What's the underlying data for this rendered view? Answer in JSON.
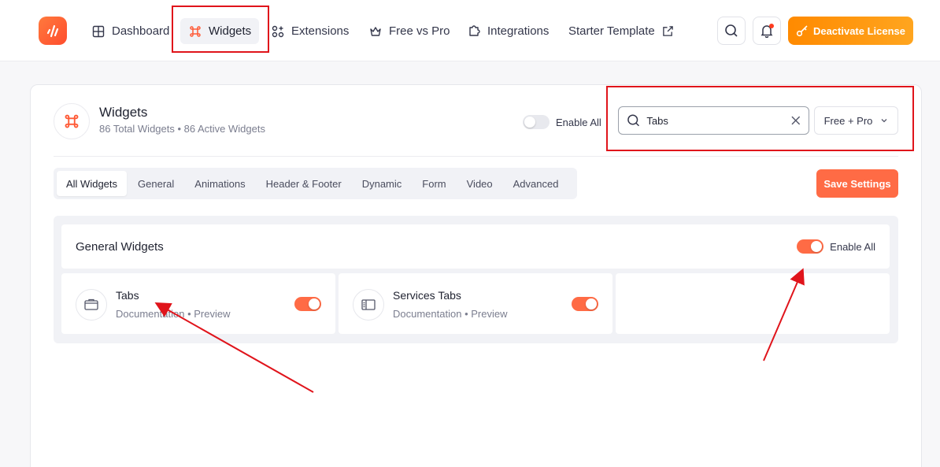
{
  "nav": {
    "items": [
      {
        "label": "Dashboard",
        "icon": "grid-icon"
      },
      {
        "label": "Widgets",
        "icon": "command-icon",
        "active": true
      },
      {
        "label": "Extensions",
        "icon": "extensions-icon"
      },
      {
        "label": "Free vs Pro",
        "icon": "crown-icon"
      },
      {
        "label": "Integrations",
        "icon": "puzzle-icon"
      },
      {
        "label": "Starter Template",
        "icon": "external-link-icon"
      }
    ],
    "deactivate_label": "Deactivate License"
  },
  "widgets": {
    "title": "Widgets",
    "subtitle": "86 Total Widgets • 86 Active Widgets",
    "enable_all_label": "Enable All",
    "enable_all_on": false,
    "search": {
      "value": "Tabs",
      "placeholder": "Search"
    },
    "filter_label": "Free + Pro",
    "tabs": [
      "All Widgets",
      "General",
      "Animations",
      "Header & Footer",
      "Dynamic",
      "Form",
      "Video",
      "Advanced"
    ],
    "active_tab": "All Widgets",
    "save_label": "Save Settings"
  },
  "group": {
    "title": "General Widgets",
    "enable_all_label": "Enable All",
    "enable_all_on": true,
    "items": [
      {
        "name": "Tabs",
        "doc_label": "Documentation",
        "separator": "•",
        "preview_label": "Preview",
        "enabled": true,
        "icon": "browser-tabs-icon"
      },
      {
        "name": "Services Tabs",
        "doc_label": "Documentation",
        "separator": "•",
        "preview_label": "Preview",
        "enabled": true,
        "icon": "services-tabs-icon"
      }
    ]
  },
  "colors": {
    "accent": "#ff6b45",
    "license_orange": "#ff9a10",
    "annotation_red": "#e0141b"
  }
}
